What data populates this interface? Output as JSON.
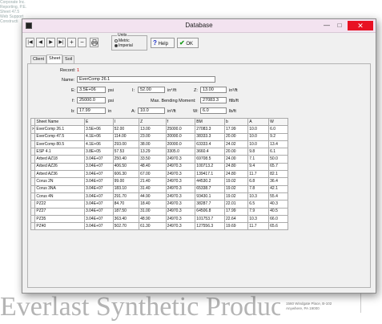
{
  "background": {
    "topleft_lines": [
      "Corporate Inc.",
      "Reporting, P.E.",
      "",
      "",
      "",
      "",
      "",
      "",
      "Sheet 47.5",
      "",
      "",
      "Web Support",
      "Constructi"
    ],
    "footer_brand": "Everlast Synthetic Products",
    "footer_address_lines": [
      "1560 Windgate Place, B-102",
      "Anywhere, PA 19000"
    ]
  },
  "window": {
    "title": "Database",
    "min_label": "—",
    "max_label": "□",
    "close_label": "✕"
  },
  "toolbar": {
    "nav_first": "|◀",
    "nav_prev": "◀",
    "nav_next": "▶",
    "nav_last": "▶|",
    "add": "+",
    "remove": "−",
    "print_icon": "printer-icon",
    "units_legend": "Units",
    "units_metric": "Metric",
    "units_imperial": "Imperial",
    "units_selected": "Imperial",
    "help_label": "Help",
    "ok_label": "OK"
  },
  "tabs": [
    "Client",
    "Sheet",
    "Soil"
  ],
  "active_tab": "Sheet",
  "form": {
    "record_label": "Record:",
    "record_value": "1",
    "name_label": "Name:",
    "name_value": "EverComp 26.1",
    "e_label": "E:",
    "e_value": "3.5E+06",
    "e_unit": "psi",
    "i_label": "I:",
    "i_value": "52.00",
    "i_unit": "in⁴/ft",
    "z_label": "Z:",
    "z_value": "13.00",
    "z_unit": "in³/ft",
    "f_label": "f:",
    "f_value": "25000.0",
    "f_unit": "psi",
    "mbm_label": "Max. Bending Moment:",
    "mbm_value": "27083.3",
    "mbm_unit": "ftlb/ft",
    "b_label": "b:",
    "b_value": "17.99",
    "b_unit": "in",
    "a_label": "A:",
    "a_value": "10.0",
    "a_unit": "in²/ft",
    "w_label": "W:",
    "w_value": "6.0",
    "w_unit": "lb/ft"
  },
  "table": {
    "columns": [
      "Sheet Name",
      "E",
      "I",
      "Z",
      "f",
      "BM",
      "b",
      "A",
      "W"
    ],
    "current_row_marker": ">",
    "rows": [
      [
        "EverComp 26.1",
        "3.5E+06",
        "52.00",
        "13.00",
        "25000.0",
        "27083.3",
        "17.99",
        "10.0",
        "6.0"
      ],
      [
        "EverComp 47.5",
        "4.1E+06",
        "114.00",
        "23.00",
        "20000.0",
        "38333.3",
        "20.00",
        "10.0",
        "9.2"
      ],
      [
        "EverComp 80.5",
        "4.1E+06",
        "293.00",
        "38.00",
        "20000.0",
        "63333.4",
        "24.02",
        "10.0",
        "13.4"
      ],
      [
        "ESP 4.1",
        "3.8E+05",
        "57.53",
        "13.29",
        "3305.0",
        "3660.4",
        "20.00",
        "9.8",
        "6.1"
      ],
      [
        "Arbed AZ18",
        "3.04E+07",
        "250.40",
        "33.50",
        "24970.3",
        "69708.5",
        "24.00",
        "7.1",
        "50.0"
      ],
      [
        "Arbed AZ26",
        "3.04E+07",
        "406.50",
        "48.40",
        "24970.3",
        "100713.2",
        "24.80",
        "9.4",
        "65.7"
      ],
      [
        "Arbed AZ36",
        "3.04E+07",
        "606.30",
        "67.00",
        "24970.3",
        "139417.1",
        "24.80",
        "11.7",
        "82.1"
      ],
      [
        "Corus 2N",
        "3.04E+07",
        "99.00",
        "21.40",
        "24970.3",
        "44530.2",
        "19.02",
        "6.8",
        "36.4"
      ],
      [
        "Corus 3NA",
        "3.04E+07",
        "183.10",
        "31.40",
        "24970.3",
        "65338.7",
        "19.02",
        "7.8",
        "42.1"
      ],
      [
        "Corus 4N",
        "3.04E+07",
        "291.70",
        "44.90",
        "24970.3",
        "93430.1",
        "19.02",
        "10.3",
        "55.4"
      ],
      [
        "PZ22",
        "3.04E+07",
        "84.70",
        "18.40",
        "24970.3",
        "38287.7",
        "22.01",
        "6.5",
        "40.3"
      ],
      [
        "PZ27",
        "3.04E+07",
        "187.50",
        "31.00",
        "24970.3",
        "64506.8",
        "17.99",
        "7.9",
        "40.5"
      ],
      [
        "PZ35",
        "3.04E+07",
        "363.40",
        "48.90",
        "24970.3",
        "101753.7",
        "22.64",
        "10.3",
        "66.0"
      ],
      [
        "PZ40",
        "3.04E+07",
        "502.70",
        "61.30",
        "24970.3",
        "127556.3",
        "19.69",
        "11.7",
        "65.6"
      ]
    ]
  }
}
